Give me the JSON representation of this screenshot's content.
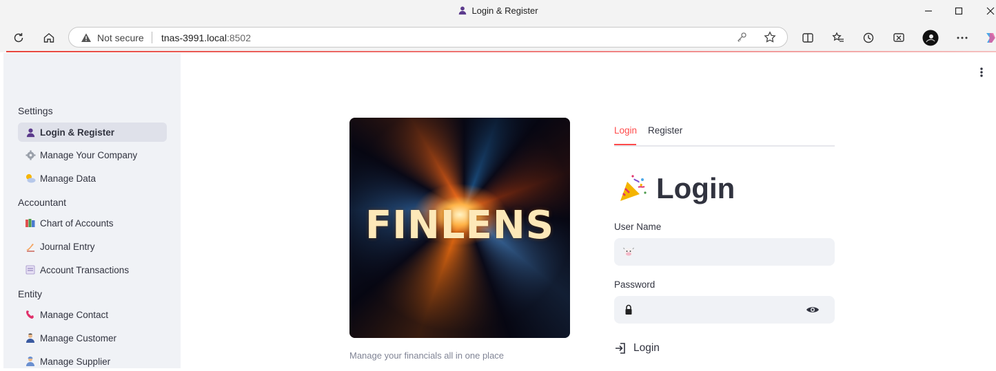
{
  "window": {
    "title": "Login & Register"
  },
  "browser": {
    "security_label": "Not secure",
    "url_host": "tnas-3991.local",
    "url_port": ":8502"
  },
  "sidebar": {
    "sections": [
      {
        "header": "Settings",
        "items": [
          {
            "label": "Login & Register",
            "icon": "bust-silhouette-icon",
            "active": true
          },
          {
            "label": "Manage Your Company",
            "icon": "gear-icon"
          },
          {
            "label": "Manage Data",
            "icon": "sun-behind-cloud-icon"
          }
        ]
      },
      {
        "header": "Accountant",
        "items": [
          {
            "label": "Chart of Accounts",
            "icon": "books-icon"
          },
          {
            "label": "Journal Entry",
            "icon": "writing-hand-icon"
          },
          {
            "label": "Account Transactions",
            "icon": "receipt-icon"
          }
        ]
      },
      {
        "header": "Entity",
        "items": [
          {
            "label": "Manage Contact",
            "icon": "telephone-icon"
          },
          {
            "label": "Manage Customer",
            "icon": "person-icon"
          },
          {
            "label": "Manage Supplier",
            "icon": "worker-icon"
          }
        ]
      }
    ]
  },
  "main": {
    "hero_text": "FINLENS",
    "caption": "Manage your financials all in one place",
    "tabs": [
      {
        "label": "Login",
        "active": true
      },
      {
        "label": "Register",
        "active": false
      }
    ],
    "heading": "Login",
    "username_label": "User Name",
    "username_value": "",
    "password_label": "Password",
    "password_value": "",
    "login_button": "Login"
  },
  "colors": {
    "accent": "#ff4b4b",
    "sidebar_bg": "#f0f2f6",
    "input_bg": "#f0f2f6"
  }
}
